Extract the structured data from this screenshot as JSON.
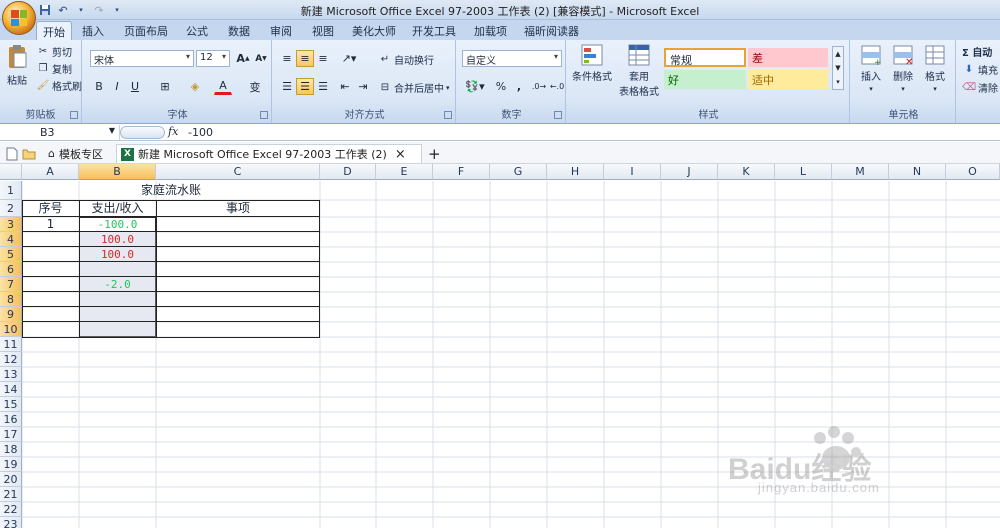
{
  "window": {
    "title": "新建 Microsoft Office Excel 97-2003 工作表 (2)  [兼容模式] - Microsoft Excel"
  },
  "ribbon_tabs": [
    "开始",
    "插入",
    "页面布局",
    "公式",
    "数据",
    "审阅",
    "视图",
    "美化大师",
    "开发工具",
    "加载项",
    "福昕阅读器"
  ],
  "clipboard": {
    "paste": "粘贴",
    "cut": "剪切",
    "copy": "复制",
    "format_painter": "格式刷",
    "label": "剪贴板"
  },
  "font": {
    "name": "宋体",
    "size": "12",
    "label": "字体",
    "bold": "B",
    "italic": "I",
    "underline": "U",
    "font_color": "A",
    "phonetic": "变"
  },
  "alignment": {
    "wrap": "自动换行",
    "merge": "合并后居中",
    "label": "对齐方式"
  },
  "number": {
    "format": "自定义",
    "percent": "%",
    "comma": ",",
    "label": "数字"
  },
  "styles": {
    "conditional": "条件格式",
    "table": "套用\n表格格式",
    "normal": "常规",
    "bad": "差",
    "good": "好",
    "neutral": "适中",
    "label": "样式",
    "colors": {
      "normal_bg": "#ffffff",
      "bad_bg": "#ffc7ce",
      "bad_fg": "#9c0006",
      "good_bg": "#c6efce",
      "good_fg": "#006100",
      "neutral_bg": "#ffeb9c",
      "neutral_fg": "#9c6500"
    }
  },
  "cells_group": {
    "insert": "插入",
    "delete": "删除",
    "format": "格式",
    "label": "单元格"
  },
  "editing": {
    "autosum": "Σ 自动",
    "fill": "填充",
    "clear": "清除"
  },
  "formula_bar": {
    "name_box": "B3",
    "fx": "fx",
    "value": "-100"
  },
  "doc_tabs": {
    "templates": "模板专区",
    "workbook": "新建 Microsoft Office Excel 97-2003 工作表 (2)",
    "close": "×",
    "add": "+"
  },
  "columns": [
    "A",
    "B",
    "C",
    "D",
    "E",
    "F",
    "G",
    "H",
    "I",
    "J",
    "K",
    "L",
    "M",
    "N",
    "O"
  ],
  "rows": [
    "1",
    "2",
    "3",
    "4",
    "5",
    "6",
    "7",
    "8",
    "9",
    "10",
    "11",
    "12",
    "13",
    "14",
    "15",
    "16",
    "17",
    "18",
    "19",
    "20",
    "21",
    "22",
    "23"
  ],
  "sheet": {
    "title": "家庭流水账",
    "headers": {
      "a": "序号",
      "b": "支出/收入",
      "c": "事项"
    },
    "a3": "1",
    "b3": "-100.0",
    "b4": "100.0",
    "b5": "100.0",
    "b7": "-2.0",
    "colors": {
      "negative": "#22c55e",
      "positive": "#dc2626",
      "selection": "#e6e9f2"
    }
  },
  "watermark": {
    "brand": "Baidu经验",
    "url": "jingyan.baidu.com"
  }
}
